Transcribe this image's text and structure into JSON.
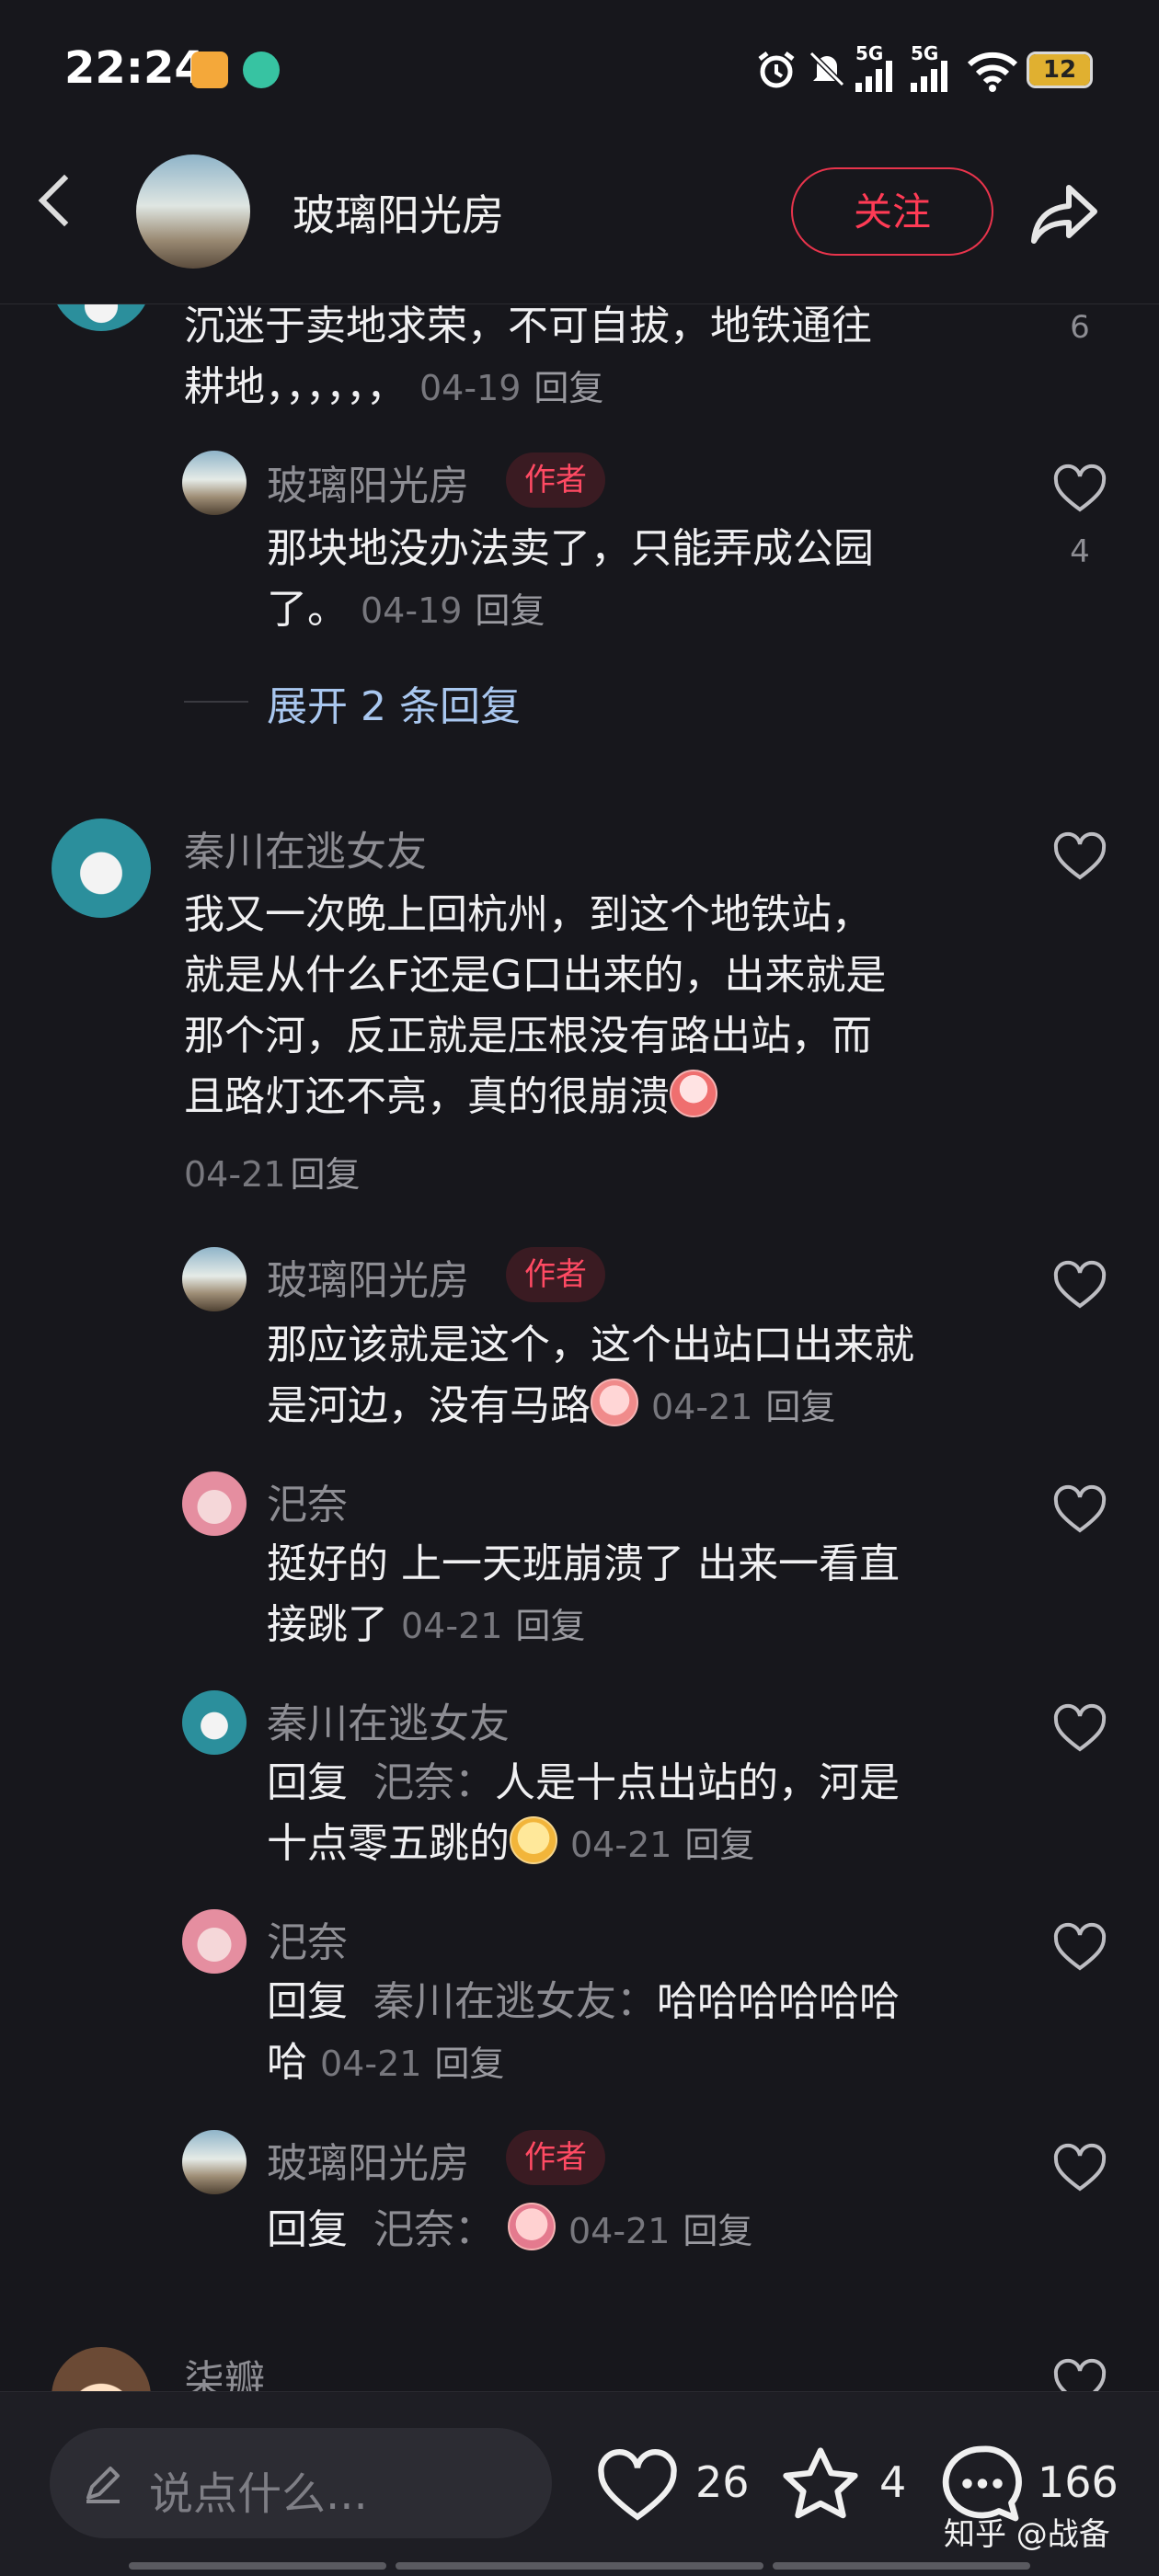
{
  "status_bar": {
    "time": "22:24",
    "network": "5G",
    "network2": "5G",
    "battery": "12",
    "icons": [
      "app-notification-icon",
      "refresh-icon",
      "alarm-icon",
      "mute-icon",
      "signal-icon",
      "signal-icon",
      "wifi-icon",
      "battery-icon"
    ]
  },
  "header": {
    "title": "玻璃阳光房",
    "follow_label": "关注",
    "icons": [
      "back-icon",
      "share-icon"
    ]
  },
  "comments": {
    "c0": {
      "text1": "沉迷于卖地求荣，不可自拔，地铁通往",
      "text2": "耕地，，，，，，",
      "date": "04-19",
      "reply": "回复",
      "likes": "6"
    },
    "r0": {
      "user": "玻璃阳光房",
      "badge": "作者",
      "text1": "那块地没办法卖了，只能弄成公园",
      "text2": "了。",
      "date": "04-19",
      "reply": "回复",
      "likes": "4"
    },
    "expand": "展开 2 条回复",
    "c1": {
      "user": "秦川在逃女友",
      "lines": [
        "我又一次晚上回杭州，到这个地铁站，",
        "就是从什么F还是G口出来的，出来就是",
        "那个河，反正就是压根没有路出站，而",
        "且路灯还不亮，真的很崩溃"
      ],
      "date": "04-21",
      "reply": "回复"
    },
    "r1": {
      "user": "玻璃阳光房",
      "badge": "作者",
      "text1": "那应该就是这个，这个出站口出来就",
      "text2": "是河边，没有马路",
      "date": "04-21",
      "reply": "回复"
    },
    "r2": {
      "user": "汜奈",
      "text1": "挺好的 上一天班崩溃了 出来一看直",
      "text2": "接跳了",
      "date": "04-21",
      "reply": "回复"
    },
    "r3": {
      "user": "秦川在逃女友",
      "prefix": "回复",
      "mention": "汜奈",
      "colon": "：",
      "text1": "人是十点出站的，河是",
      "text2": "十点零五跳的",
      "date": "04-21",
      "reply": "回复"
    },
    "r4": {
      "user": "汜奈",
      "prefix": "回复",
      "mention": "秦川在逃女友",
      "colon": "：",
      "text1": "哈哈哈哈哈哈",
      "text2": "哈",
      "date": "04-21",
      "reply": "回复"
    },
    "r5": {
      "user": "玻璃阳光房",
      "badge": "作者",
      "prefix": "回复",
      "mention": "汜奈",
      "colon": "：",
      "date": "04-21",
      "reply": "回复"
    },
    "c2": {
      "user": "柒瓣"
    }
  },
  "bottom_bar": {
    "input_placeholder": "说点什么...",
    "like_count": "26",
    "favorite_count": "4",
    "comment_count": "166",
    "watermark": "知乎 @战备"
  },
  "colors": {
    "accent": "#ff3b55",
    "background": "#17171c",
    "link": "#a9c7ef"
  }
}
